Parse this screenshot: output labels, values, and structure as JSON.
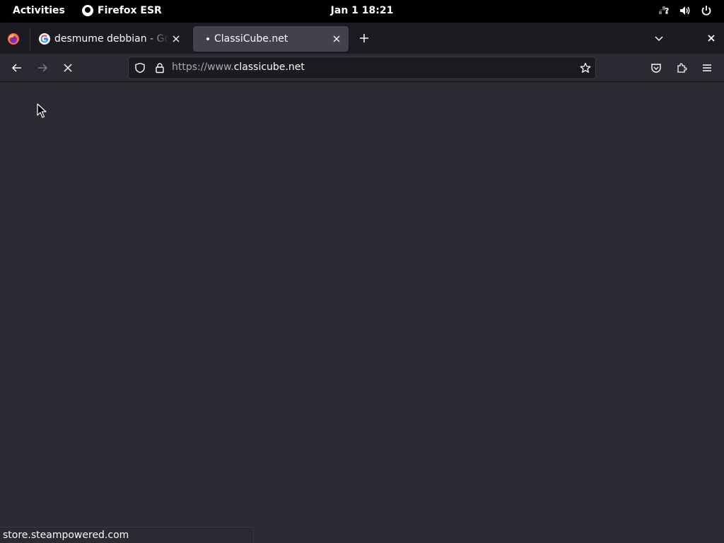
{
  "system_bar": {
    "activities": "Activities",
    "app_name": "Firefox ESR",
    "clock": "Jan 1  18:21",
    "icons": [
      "network-icon",
      "volume-icon",
      "power-icon"
    ]
  },
  "tabs": [
    {
      "title": "desmume debbian - Google Search",
      "favicon": "google-icon",
      "active": false
    },
    {
      "title": "ClassiCube.net",
      "favicon": "loading-dot",
      "active": true
    }
  ],
  "toolbar": {
    "url_prefix": "https://www.",
    "url_domain": "classicube.net",
    "icons": [
      "back-arrow-icon",
      "forward-arrow-icon",
      "stop-loading-icon",
      "shield-icon",
      "lock-icon",
      "bookmark-star-icon",
      "pocket-icon",
      "extensions-icon",
      "hamburger-menu-icon"
    ]
  },
  "status_bar": {
    "text": "store.steampowered.com"
  },
  "colors": {
    "topbar_bg": "#000000",
    "tabstrip_bg": "#1c1b22",
    "toolbar_bg": "#2b2a33",
    "active_tab_bg": "#42414d",
    "content_bg": "#2b2a33",
    "text": "#fbfbfe"
  }
}
